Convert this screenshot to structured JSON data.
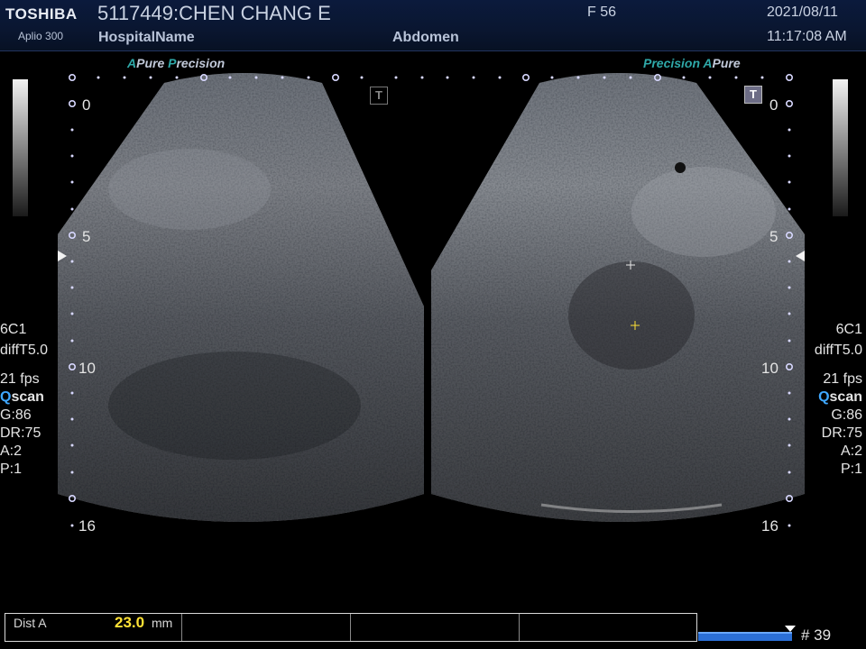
{
  "header": {
    "brand": "TOSHIBA",
    "model": "Aplio 300",
    "patient": "5117449:CHEN CHANG E",
    "hospital": "HospitalName",
    "sex_age": "F  56",
    "exam": "Abdomen",
    "date": "2021/08/11",
    "time": "11:17:08 AM"
  },
  "logos": {
    "left": {
      "a1": "A",
      "pure": "Pure",
      "p": "P",
      "recision": "recision"
    },
    "right": {
      "precision": "Precision",
      "a2": "A",
      "pure": "Pure"
    }
  },
  "params": {
    "probe": "6C1",
    "freq": "diffT5.0",
    "fps": "21 fps",
    "qscan_q": "Q",
    "qscan_rest": "scan",
    "gain": "G:86",
    "dr": "DR:75",
    "a": "A:2",
    "p": "P:1"
  },
  "depth_scale": [
    "0",
    "5",
    "10",
    "16"
  ],
  "t_button": "T",
  "measurement": {
    "label": "Dist A",
    "value": "23.0",
    "unit": "mm"
  },
  "frame": "# 39",
  "colors": {
    "accent_teal": "#2fa9a9",
    "measure_yellow": "#ffe135",
    "qscan_blue": "#3fa7ff",
    "cine_bar": "#2b6fd6"
  }
}
